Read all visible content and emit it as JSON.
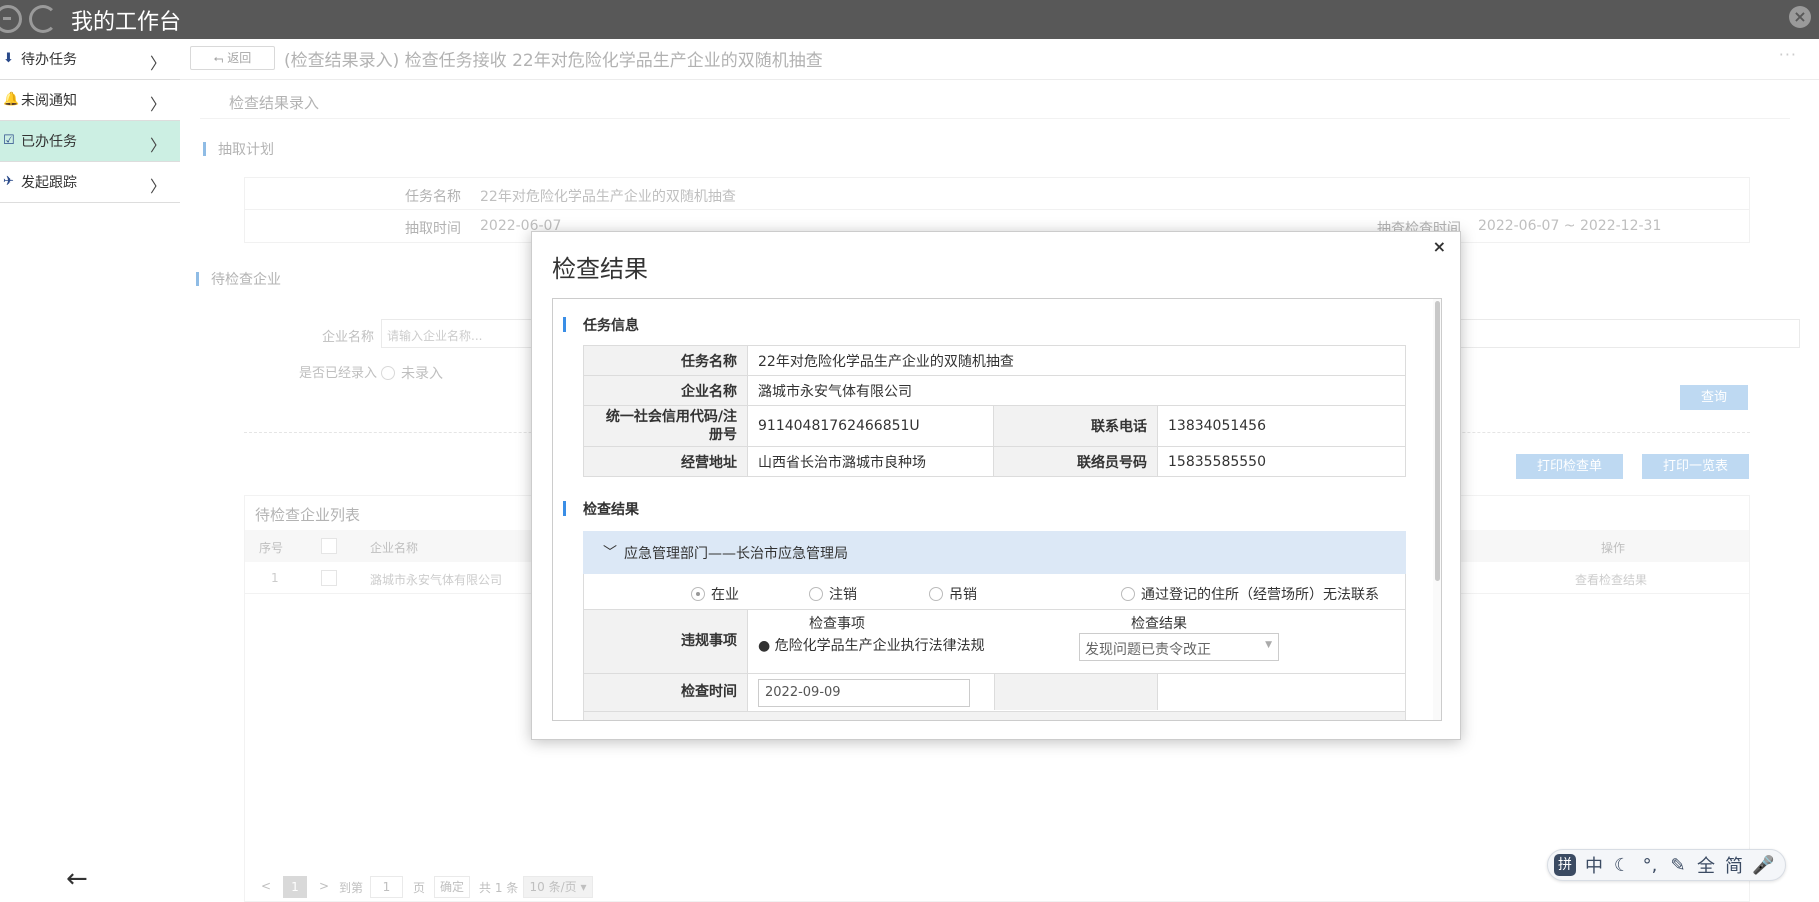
{
  "app": {
    "title": "我的工作台"
  },
  "sidebar": {
    "items": [
      {
        "label": "待办任务",
        "active": false
      },
      {
        "label": "未阅通知",
        "active": false
      },
      {
        "label": "已办任务",
        "active": true
      },
      {
        "label": "发起跟踪",
        "active": false
      }
    ],
    "back_arrow": "←"
  },
  "header": {
    "return_label": "返回",
    "page_title": "(检查结果录入) 检查任务接收 22年对危险化学品生产企业的双随机抽查",
    "more": "···"
  },
  "page": {
    "section_title": "检查结果录入",
    "plan": {
      "heading": "抽取计划",
      "task_name_label": "任务名称",
      "task_name": "22年对危险化学品生产企业的双随机抽查",
      "draw_time_label": "抽取时间",
      "draw_time": "2022-06-07",
      "check_time_label": "抽查检查时间",
      "check_time": "2022-06-07 ~ 2022-12-31"
    },
    "pending": {
      "heading": "待检查企业",
      "company_name_label": "企业名称",
      "company_name_placeholder": "请输入企业名称...",
      "recorded_label": "是否已经录入",
      "not_recorded": "未录入",
      "query_button": "查询",
      "print_checklist_button": "打印检查单",
      "print_overview_button": "打印一览表"
    },
    "list": {
      "title": "待检查企业列表",
      "columns": {
        "seq": "序号",
        "company": "企业名称",
        "ops": "操作"
      },
      "rows": [
        {
          "seq": "1",
          "company": "潞城市永安气体有限公司",
          "action": "查看检查结果"
        }
      ]
    },
    "pager": {
      "prev": "<",
      "current": "1",
      "next": ">",
      "goto_label": "到第",
      "goto_value": "1",
      "page_unit": "页",
      "confirm": "确定",
      "total": "共 1 条",
      "page_size": "10 条/页"
    }
  },
  "modal": {
    "title": "检查结果",
    "close": "×",
    "task_info": {
      "heading": "任务信息",
      "task_name_label": "任务名称",
      "task_name": "22年对危险化学品生产企业的双随机抽查",
      "company_label": "企业名称",
      "company": "潞城市永安气体有限公司",
      "credit_code_label": "统一社会信用代码/注册号",
      "credit_code": "91140481762466851U",
      "phone_label": "联系电话",
      "phone": "13834051456",
      "address_label": "经营地址",
      "address": "山西省长治市潞城市良种场",
      "liaison_phone_label": "联络员号码",
      "liaison_phone": "15835585550"
    },
    "result": {
      "heading": "检查结果",
      "department": "应急管理部门——长治市应急管理局",
      "status_options": [
        "在业",
        "注销",
        "吊销",
        "通过登记的住所（经营场所）无法联系"
      ],
      "selected_status": "在业",
      "violation_label": "违规事项",
      "item_col": "检查事项",
      "result_col": "检查结果",
      "item": "● 危险化学品生产企业执行法律法规",
      "item_result": "发现问题已责令改正",
      "check_time_label": "检查时间",
      "check_time": "2022-09-09"
    }
  },
  "ime": {
    "pin": "拼",
    "items": [
      "中",
      "☾",
      "°,",
      "✎",
      "全",
      "简",
      "🎤"
    ]
  }
}
